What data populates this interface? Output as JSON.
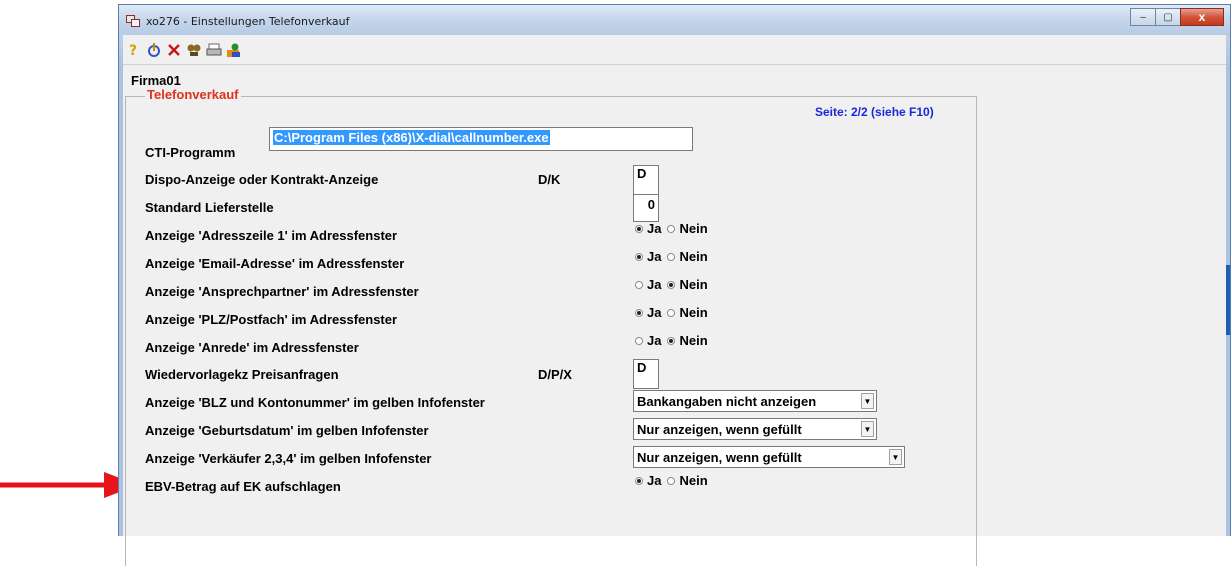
{
  "window": {
    "title": "xo276 - Einstellungen Telefonverkauf",
    "buttons": {
      "minimize": "–",
      "maximize": "▢",
      "close": "x"
    }
  },
  "toolbar": {
    "icons": [
      "help-icon",
      "info-icon",
      "close-icon",
      "search-icon",
      "print-icon",
      "user-icon"
    ]
  },
  "company": "Firma01",
  "group": {
    "title": "Telefonverkauf",
    "page_info": "Seite: 2/2 (siehe F10)"
  },
  "fields": {
    "cti": {
      "label": "CTI-Programm",
      "value": "C:\\Program Files (x86)\\X-dial\\callnumber.exe"
    },
    "dispo": {
      "label": "Dispo-Anzeige oder Kontrakt-Anzeige",
      "code": "D/K",
      "value": "D"
    },
    "lieferstelle": {
      "label": "Standard Lieferstelle",
      "value": "0"
    },
    "adresszeile": {
      "label": "Anzeige 'Adresszeile 1' im Adressfenster",
      "ja": "Ja",
      "nein": "Nein",
      "selected": "Ja"
    },
    "email": {
      "label": "Anzeige 'Email-Adresse' im Adressfenster",
      "ja": "Ja",
      "nein": "Nein",
      "selected": "Ja"
    },
    "ansprechpartner": {
      "label": "Anzeige 'Ansprechpartner' im Adressfenster",
      "ja": "Ja",
      "nein": "Nein",
      "selected": "Nein"
    },
    "plz": {
      "label": "Anzeige 'PLZ/Postfach' im Adressfenster",
      "ja": "Ja",
      "nein": "Nein",
      "selected": "Ja"
    },
    "anrede": {
      "label": "Anzeige 'Anrede' im Adressfenster",
      "ja": "Ja",
      "nein": "Nein",
      "selected": "Nein"
    },
    "wiedervorlage": {
      "label": "Wiedervorlagekz Preisanfragen",
      "code": "D/P/X",
      "value": "D"
    },
    "blz": {
      "label": "Anzeige 'BLZ und Kontonummer' im gelben Infofenster",
      "value": "Bankangaben nicht anzeigen"
    },
    "geburtsdatum": {
      "label": "Anzeige 'Geburtsdatum' im gelben Infofenster",
      "value": "Nur anzeigen, wenn gefüllt"
    },
    "verkaeufer": {
      "label": "Anzeige 'Verkäufer 2,3,4' im gelben Infofenster",
      "value": "Nur anzeigen, wenn gefüllt"
    },
    "ebv": {
      "label": "EBV-Betrag auf EK aufschlagen",
      "ja": "Ja",
      "nein": "Nein",
      "selected": "Ja"
    }
  },
  "colors": {
    "group_title": "#e0301e",
    "page_info": "#1a28d8",
    "selection": "#3399ff",
    "arrow": "#e8141c"
  }
}
